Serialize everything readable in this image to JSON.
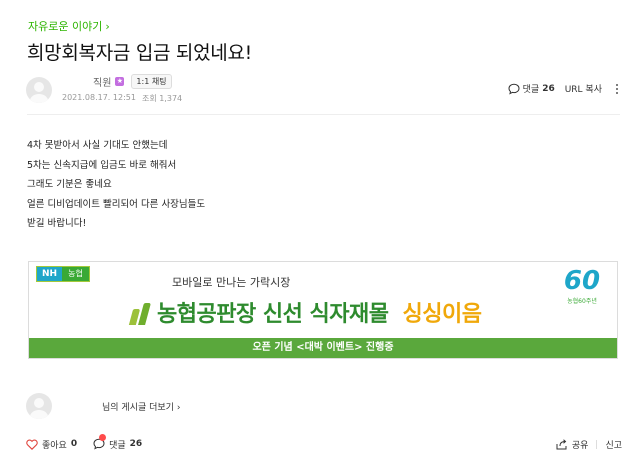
{
  "board": {
    "name": "자유로운 이야기",
    "chevron": "›"
  },
  "post": {
    "title": "희망회복자금 입금 되었네요!",
    "author": {
      "grade": "직원",
      "chat_label": "1:1 채팅"
    },
    "date": "2021.08.17. 12:51",
    "views_label": "조회 1,374",
    "comment_label": "댓글",
    "comment_count": "26",
    "url_copy_label": "URL 복사",
    "lines": [
      "4차 못받아서 사실 기대도 안했는데",
      "5차는 신속지급에 입금도 바로 해줘서",
      "그래도 기분은 좋네요",
      "얼른 디비업데이트 빨리되어 다른 사장님들도",
      "받길 바랍니다!"
    ]
  },
  "banner": {
    "logo_left": "NH",
    "logo_right": "농협",
    "subtitle": "모바일로 만나는 가락시장",
    "headline": "농협공판장 신선 식자재몰",
    "brand": "싱싱이음",
    "anniversary_number": "60",
    "anniversary_caption": "농협60주년",
    "event_bar": "오픈 기념 <대박 이벤트> 진행중"
  },
  "author_more": {
    "link_label": "님의 게시글 더보기 ›"
  },
  "bottom": {
    "like_label": "좋아요",
    "like_count": "0",
    "comment_label": "댓글",
    "comment_count": "26",
    "share_label": "공유",
    "report_label": "신고"
  },
  "colors": {
    "accent_green": "#2db400",
    "like_red": "#e0433b",
    "badge_purple": "#c36ee0"
  },
  "icons": [
    "chevron-right-icon",
    "avatar-placeholder-icon",
    "comment-icon",
    "more-vertical-icon",
    "heart-icon",
    "share-icon"
  ]
}
